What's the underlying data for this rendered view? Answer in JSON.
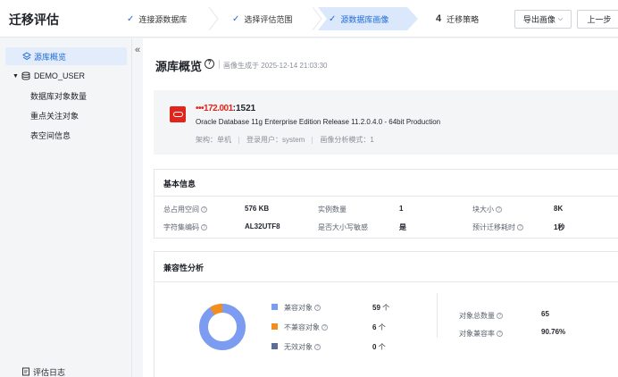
{
  "app": {
    "title": "迁移评估"
  },
  "steps": [
    {
      "label": "连接源数据库",
      "state": "done"
    },
    {
      "label": "选择评估范围",
      "state": "done"
    },
    {
      "label": "源数据库画像",
      "state": "active"
    },
    {
      "label": "迁移策略",
      "number": "4",
      "state": "todo"
    }
  ],
  "toolbar": {
    "export_label": "导出画像",
    "prev_label": "上一步"
  },
  "sidebar": {
    "items": [
      {
        "label": "源库概览",
        "active": true
      },
      {
        "label": "DEMO_USER"
      },
      {
        "label": "数据库对象数量"
      },
      {
        "label": "重点关注对象"
      },
      {
        "label": "表空间信息"
      }
    ],
    "log_label": "评估日志"
  },
  "overview": {
    "title": "源库概览",
    "generated": "画像生成于 2025-12-14 21:03:30",
    "db": {
      "host_masked": "•••172.001",
      "port": ":1521",
      "version": "Oracle Database 11g Enterprise Edition Release 11.2.0.4.0 - 64bit Production",
      "arch": "架构：单机",
      "user": "登录用户：system",
      "mode": "画像分析模式：1"
    }
  },
  "basic": {
    "title": "基本信息",
    "items": [
      {
        "label": "总占用空间",
        "value": "576 KB"
      },
      {
        "label": "实例数量",
        "value": "1"
      },
      {
        "label": "块大小",
        "value": "8K"
      },
      {
        "label": "字符集编码",
        "value": "AL32UTF8"
      },
      {
        "label": "是否大小写敏感",
        "value": "是"
      },
      {
        "label": "预计迁移耗时",
        "value": "1秒"
      }
    ]
  },
  "compat": {
    "title": "兼容性分析",
    "legend": [
      {
        "label": "兼容对象",
        "value": "59",
        "unit": "个",
        "color": "#7b9cf0"
      },
      {
        "label": "不兼容对象",
        "value": "6",
        "unit": "个",
        "color": "#f28e1e"
      },
      {
        "label": "无效对象",
        "value": "0",
        "unit": "个",
        "color": "#5b6e96"
      }
    ],
    "total_label": "对象总数量",
    "total_value": "65",
    "rate_label": "对象兼容率",
    "rate_value": "90.76%",
    "colors": {
      "compatible": "#7b9cf0",
      "incompatible": "#f28e1e",
      "invalid": "#5b6e96"
    }
  }
}
